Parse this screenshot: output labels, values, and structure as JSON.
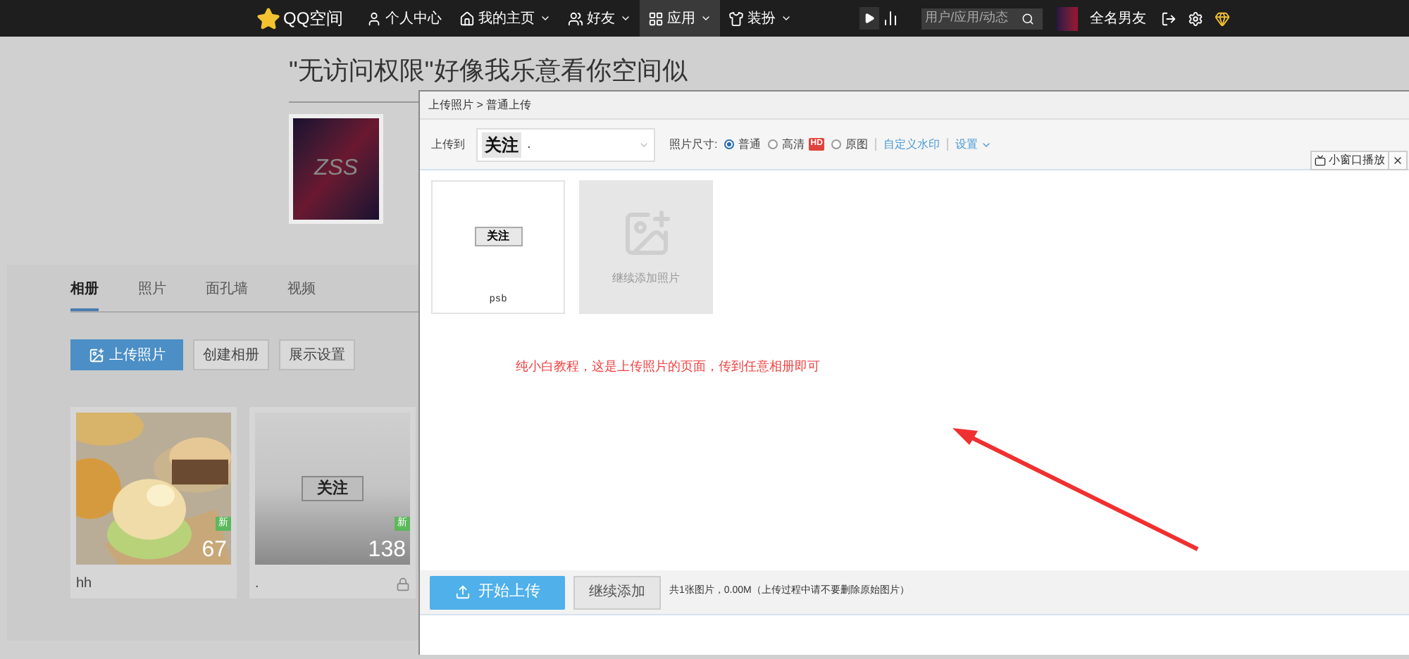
{
  "topbar": {
    "logo": "QQ空间",
    "items": [
      {
        "label": "个人中心",
        "caret": false,
        "selected": false
      },
      {
        "label": "我的主页",
        "caret": true,
        "selected": false
      },
      {
        "label": "好友",
        "caret": true,
        "selected": false
      },
      {
        "label": "应用",
        "caret": true,
        "selected": true
      },
      {
        "label": "装扮",
        "caret": true,
        "selected": false
      }
    ],
    "search": {
      "placeholder": "用户/应用/动态"
    },
    "username": "全名男友"
  },
  "profile": {
    "title": "\"无访问权限\"好像我乐意看你空间似",
    "avatar_text": "ZSS"
  },
  "album_tabs": [
    {
      "label": "相册",
      "selected": true
    },
    {
      "label": "照片",
      "selected": false
    },
    {
      "label": "面孔墙",
      "selected": false
    },
    {
      "label": "视频",
      "selected": false
    }
  ],
  "album_actions": [
    {
      "label": "上传照片",
      "kind": "primary"
    },
    {
      "label": "创建相册",
      "kind": "plain"
    },
    {
      "label": "展示设置",
      "kind": "plain"
    }
  ],
  "albums": [
    {
      "name": "hh",
      "count": "67",
      "badge": "新",
      "kind": "picture",
      "locked": false
    },
    {
      "name": ".",
      "count": "138",
      "badge": "新",
      "kind": "follow",
      "cover_text": "关注",
      "locked": true
    }
  ],
  "dialog": {
    "breadcrumb": "上传照片 > 普通上传",
    "target_label": "上传到",
    "target_thumb": "关注",
    "target_value": ".",
    "size_label": "照片尺寸:",
    "sizes": [
      {
        "label": "普通",
        "selected": true,
        "hd": false
      },
      {
        "label": "高清",
        "selected": false,
        "hd": true,
        "badge": "HD"
      },
      {
        "label": "原图",
        "selected": false,
        "hd": false
      }
    ],
    "links": [
      {
        "label": "自定义水印",
        "caret": false
      },
      {
        "label": "设置",
        "caret": true
      }
    ],
    "photos": [
      {
        "thumb_text": "关注",
        "filename": "psb"
      }
    ],
    "add_tile": "继续添加照片",
    "annotation": "纯小白教程，这是上传照片的页面，传到任意相册即可",
    "start_button": "开始上传",
    "add_button": "继续添加",
    "summary": "共1张图片，0.00M（上传过程中请不要删除原始图片）"
  },
  "mini_player": {
    "label": "小窗口播放"
  }
}
